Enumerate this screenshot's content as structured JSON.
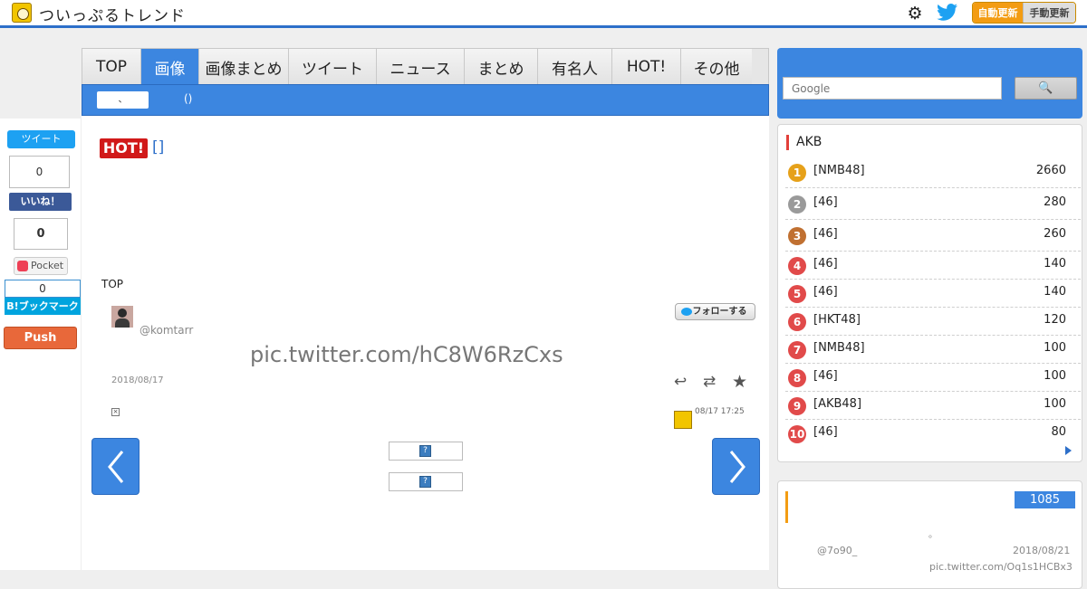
{
  "header": {
    "site_title": "ついっぷるトレンド",
    "auto_update_label": "自動更新",
    "manual_update_label": "手動更新",
    "colors": {
      "accent": "#2d6fc9",
      "update_active": "#f39c12"
    }
  },
  "nav": {
    "tabs": [
      {
        "label": "TOP"
      },
      {
        "label": "画像",
        "active": true
      },
      {
        "label": "画像まとめ"
      },
      {
        "label": "ツイート"
      },
      {
        "label": "ニュース"
      },
      {
        "label": "まとめ"
      },
      {
        "label": "有名人"
      },
      {
        "label": "HOT!"
      },
      {
        "label": "その他"
      }
    ],
    "sub_items": [
      {
        "label": "、"
      },
      {
        "label": "()"
      },
      {
        "label": "()"
      }
    ]
  },
  "share": {
    "tweet_label": "ツイート",
    "fb_count": "0",
    "fb_like_label": "いいね！",
    "pocket_count": "0",
    "pocket_label": "Pocket",
    "hatena_count": "0",
    "hatena_label": "B!ブックマーク",
    "push_label": "Push"
  },
  "content": {
    "hot_badge": "HOT!",
    "hot_link": "[]",
    "breadcrumb": "TOP",
    "tweet": {
      "username": "@komtarr",
      "follow_label": "フォローする",
      "text": "pic.twitter.com/hC8W6RzCxs",
      "date": "2018/08/17",
      "bot_time": "08/17 17:25",
      "broken_image_glyph": "×",
      "placeholder_glyph": "?"
    }
  },
  "sidebar": {
    "search_placeholder": "Google",
    "search_button_label": "🔍",
    "ranking": {
      "title": "AKB",
      "items": [
        {
          "rank": "1",
          "label": "[NMB48]",
          "count": "2660",
          "color": "#e6a11a"
        },
        {
          "rank": "2",
          "label": "[46]",
          "count": "280",
          "color": "#9a9a9a"
        },
        {
          "rank": "3",
          "label": "[46]",
          "count": "260",
          "color": "#c07031"
        },
        {
          "rank": "4",
          "label": "[46]",
          "count": "140",
          "color": "#e14a4a"
        },
        {
          "rank": "5",
          "label": "[46]",
          "count": "140",
          "color": "#e14a4a"
        },
        {
          "rank": "6",
          "label": "[HKT48]",
          "count": "120",
          "color": "#e14a4a"
        },
        {
          "rank": "7",
          "label": "[NMB48]",
          "count": "100",
          "color": "#e14a4a"
        },
        {
          "rank": "8",
          "label": "[46]",
          "count": "100",
          "color": "#e14a4a"
        },
        {
          "rank": "9",
          "label": "[AKB48]",
          "count": "100",
          "color": "#e14a4a"
        },
        {
          "rank": "10",
          "label": "[46]",
          "count": "80",
          "color": "#e14a4a"
        }
      ]
    },
    "news": {
      "count": "1085",
      "text": "。",
      "user": "@7o90_",
      "date": "2018/08/21",
      "link": "pic.twitter.com/Oq1s1HCBx3"
    }
  }
}
